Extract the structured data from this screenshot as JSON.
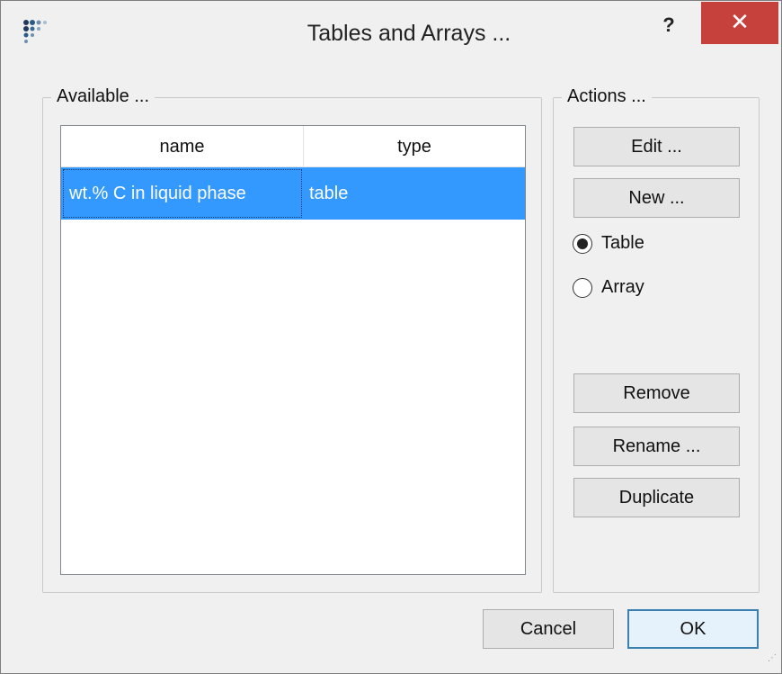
{
  "window": {
    "title": "Tables and Arrays ...",
    "help_label": "?",
    "close_label": "✕"
  },
  "available": {
    "title": "Available ...",
    "columns": [
      "name",
      "type"
    ],
    "rows": [
      {
        "name": "wt.% C in liquid phase",
        "type": "table",
        "selected": true
      }
    ]
  },
  "actions": {
    "title": "Actions ...",
    "edit_label": "Edit ...",
    "new_label": "New ...",
    "radio_table_label": "Table",
    "radio_array_label": "Array",
    "selected_radio": "Table",
    "remove_label": "Remove",
    "rename_label": "Rename ...",
    "duplicate_label": "Duplicate"
  },
  "footer": {
    "cancel_label": "Cancel",
    "ok_label": "OK"
  },
  "colors": {
    "selection": "#3399ff",
    "close_button": "#c7413c"
  }
}
